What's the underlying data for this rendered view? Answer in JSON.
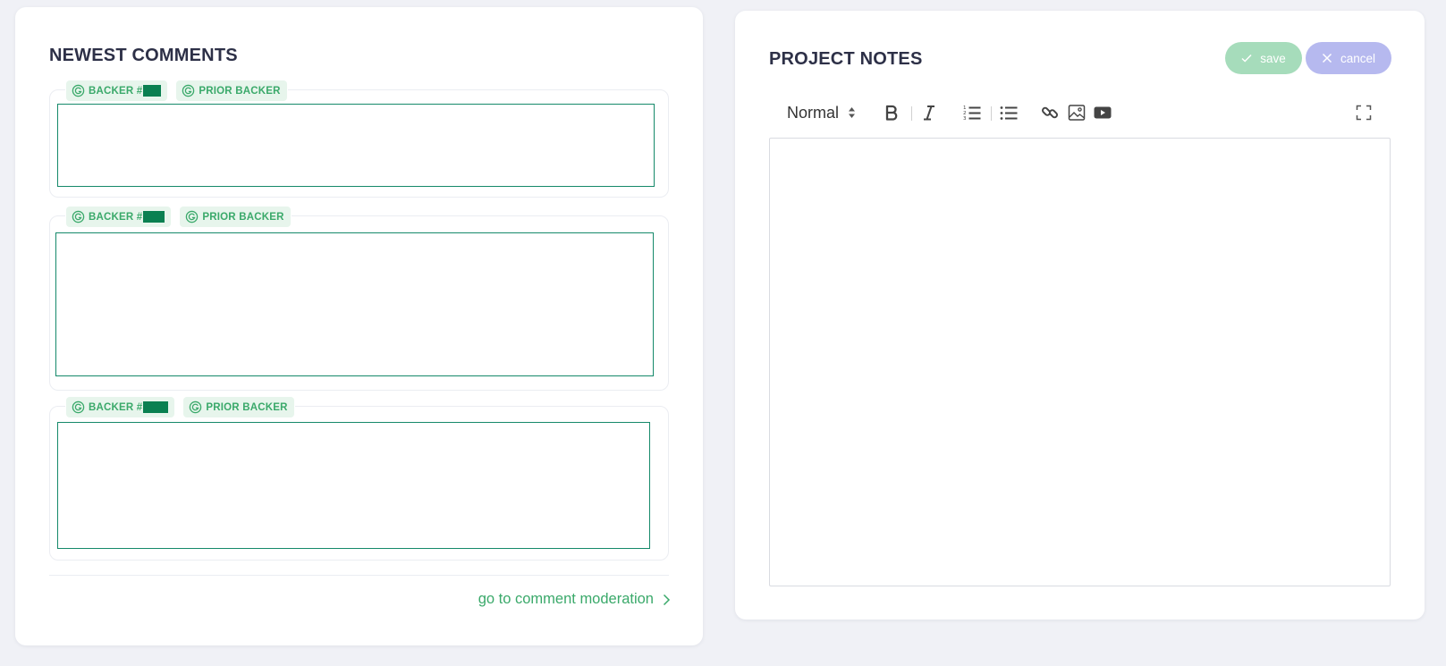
{
  "comments": {
    "title": "NEWEST COMMENTS",
    "items": [
      {
        "backer_label": "BACKER #",
        "prior_label": "PRIOR BACKER"
      },
      {
        "backer_label": "BACKER #",
        "prior_label": "PRIOR BACKER"
      },
      {
        "backer_label": "BACKER #",
        "prior_label": "PRIOR BACKER"
      }
    ],
    "moderation_link": "go to comment moderation"
  },
  "notes": {
    "title": "PROJECT NOTES",
    "save_label": "save",
    "cancel_label": "cancel",
    "format_select": "Normal"
  },
  "colors": {
    "accent_green": "#3aa96a",
    "badge_bg": "#e7f5ec",
    "comment_border": "#15896a",
    "save_bg": "#a6dcbb",
    "cancel_bg": "#b6b9ef"
  },
  "icons": {
    "badge": "g-logo-icon",
    "toolbar": [
      "bold-icon",
      "italic-icon",
      "ordered-list-icon",
      "bullet-list-icon",
      "link-icon",
      "image-icon",
      "video-icon",
      "fullscreen-icon"
    ]
  }
}
